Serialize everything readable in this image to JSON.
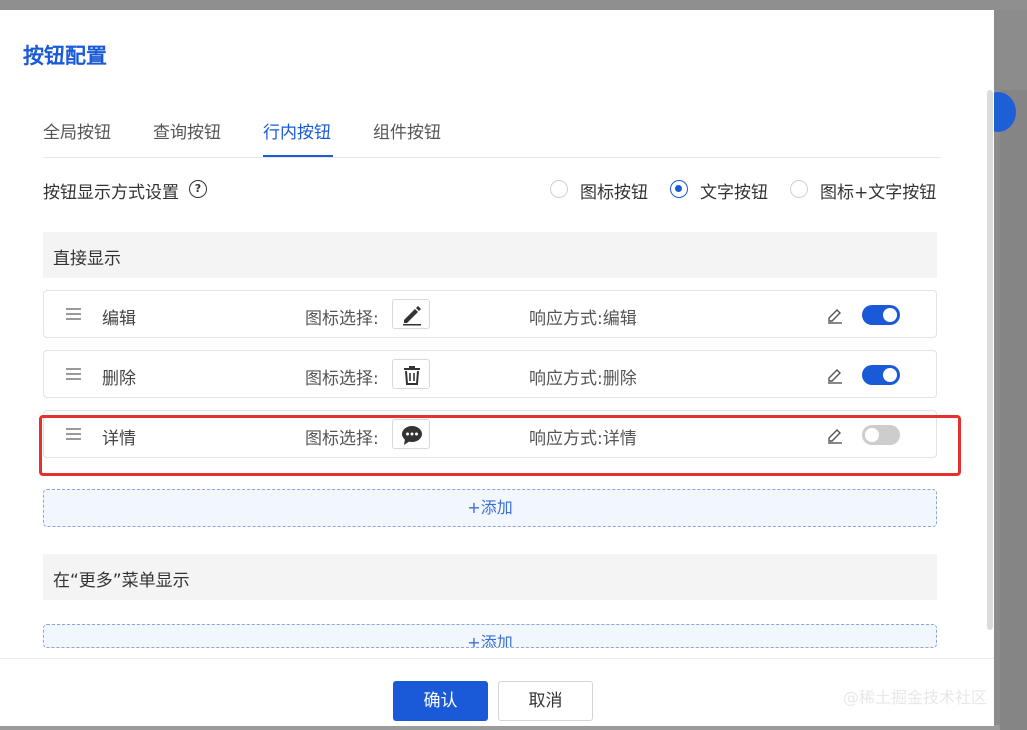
{
  "modal": {
    "title": "按钮配置"
  },
  "tabs": [
    {
      "label": "全局按钮",
      "active": false
    },
    {
      "label": "查询按钮",
      "active": false
    },
    {
      "label": "行内按钮",
      "active": true
    },
    {
      "label": "组件按钮",
      "active": false
    }
  ],
  "display_mode": {
    "label": "按钮显示方式设置",
    "help_icon": "question-circle-icon",
    "options": [
      {
        "label": "图标按钮",
        "checked": false
      },
      {
        "label": "文字按钮",
        "checked": true
      },
      {
        "label": "图标+文字按钮",
        "checked": false
      }
    ]
  },
  "direct_section": {
    "title": "直接显示",
    "rows": [
      {
        "name": "编辑",
        "icon_label": "图标选择:",
        "icon": "pencil-icon",
        "response": "响应方式:编辑",
        "enabled": true
      },
      {
        "name": "删除",
        "icon_label": "图标选择:",
        "icon": "trash-icon",
        "response": "响应方式:删除",
        "enabled": true
      },
      {
        "name": "详情",
        "icon_label": "图标选择:",
        "icon": "comment-icon",
        "response": "响应方式:详情",
        "enabled": false
      }
    ],
    "add_label": "+添加"
  },
  "more_section": {
    "title": "在“更多”菜单显示",
    "add_label": "+添加"
  },
  "footer": {
    "confirm_label": "确认",
    "cancel_label": "取消"
  },
  "watermark": "@稀土掘金技术社区",
  "colors": {
    "accent": "#1a5ad8",
    "highlight": "#e5302f",
    "switch_off": "#cdcdcd"
  }
}
